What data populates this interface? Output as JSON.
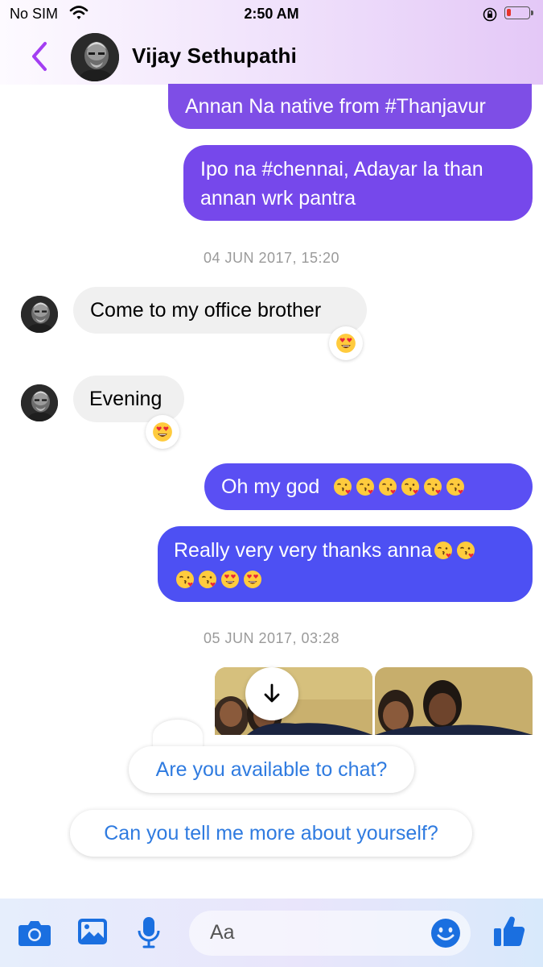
{
  "status_bar": {
    "carrier": "No SIM",
    "time": "2:50 AM"
  },
  "header": {
    "contact_name": "Vijay Sethupathi"
  },
  "messages": [
    {
      "dir": "out",
      "text": "Annan Na native from #Thanjavur"
    },
    {
      "dir": "out",
      "line1": "Ipo na #chennai, Adayar la than",
      "line2": "annan wrk pantra"
    },
    {
      "timestamp": "04 JUN 2017, 15:20"
    },
    {
      "dir": "in",
      "text": "Come to my office brother",
      "reaction": "heart-eyes"
    },
    {
      "dir": "in",
      "text": "Evening",
      "reaction": "heart-eyes"
    },
    {
      "dir": "out",
      "text": "Oh my god",
      "emojis": [
        "kiss-heart",
        "kiss-heart",
        "kiss-heart",
        "kiss-heart",
        "kiss-heart",
        "kiss-heart"
      ]
    },
    {
      "dir": "out",
      "text": "Really very very thanks anna",
      "emojis_line1": [
        "kiss-heart",
        "kiss-heart"
      ],
      "emojis_line2": [
        "kiss-heart",
        "kiss-heart",
        "heart-eyes",
        "heart-eyes"
      ]
    },
    {
      "timestamp": "05 JUN 2017, 03:28"
    }
  ],
  "suggestions": [
    "Are you available to chat?",
    "Can you tell me more about yourself?"
  ],
  "composer": {
    "placeholder": "Aa"
  },
  "icons": [
    "back-chevron-icon",
    "camera-icon",
    "gallery-icon",
    "microphone-icon",
    "emoji-icon",
    "thumbs-up-icon",
    "download-icon"
  ],
  "colors": {
    "bubble_purple_1": "#7e4ee6",
    "bubble_purple_2": "#6e4ef0",
    "bubble_blue_1": "#5a4ff3",
    "bubble_blue_2": "#4d50f3",
    "incoming_bubble": "#f0f0f0",
    "accent": "#a33ef2",
    "link_blue": "#2f7be0"
  }
}
